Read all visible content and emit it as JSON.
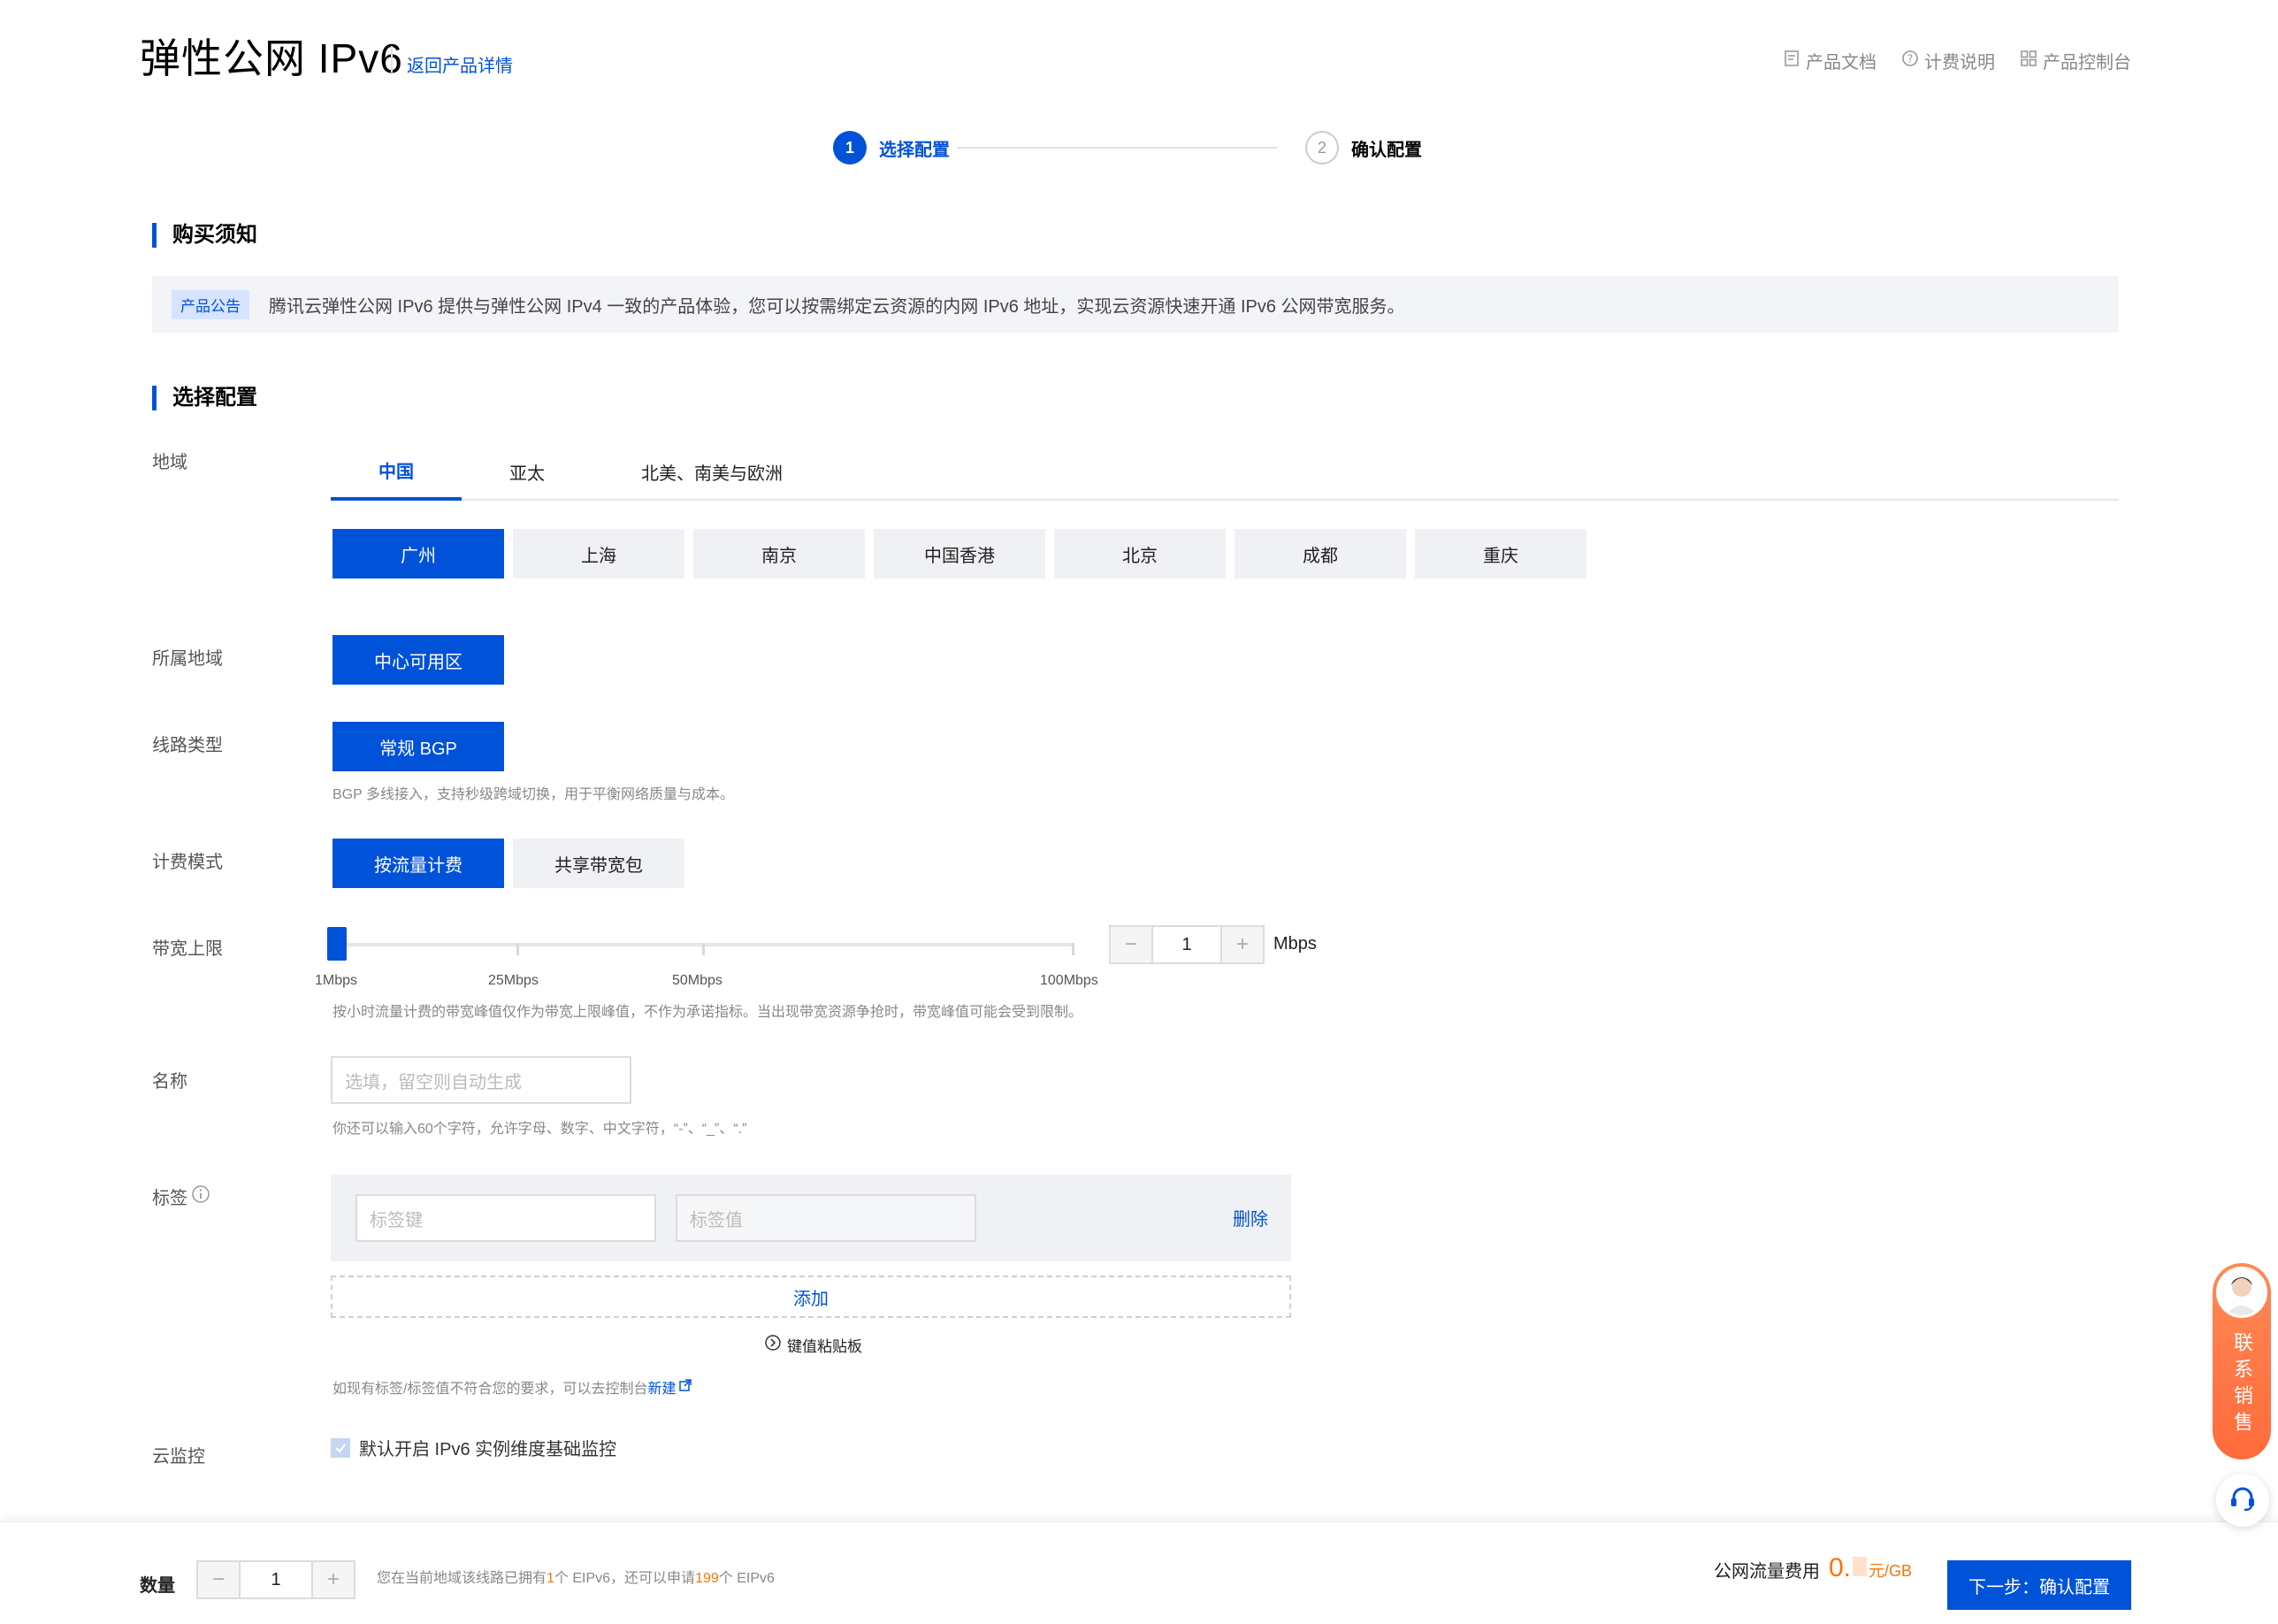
{
  "header": {
    "title": "弹性公网 IPv6",
    "back_link": "返回产品详情",
    "links": [
      {
        "label": "产品文档",
        "icon": "document-icon"
      },
      {
        "label": "计费说明",
        "icon": "question-circle-icon"
      },
      {
        "label": "产品控制台",
        "icon": "grid-icon"
      }
    ]
  },
  "steps": [
    {
      "number": "1",
      "label": "选择配置"
    },
    {
      "number": "2",
      "label": "确认配置"
    }
  ],
  "notice": {
    "section_title": "购买须知",
    "badge": "产品公告",
    "text": "腾讯云弹性公网 IPv6 提供与弹性公网 IPv4 一致的产品体验，您可以按需绑定云资源的内网 IPv6 地址，实现云资源快速开通 IPv6 公网带宽服务。"
  },
  "config": {
    "section_title": "选择配置",
    "region": {
      "label": "地域",
      "tabs": [
        "中国",
        "亚太",
        "北美、南美与欧洲"
      ],
      "cities": [
        "广州",
        "上海",
        "南京",
        "中国香港",
        "北京",
        "成都",
        "重庆"
      ]
    },
    "zone": {
      "label": "所属地域",
      "option": "中心可用区"
    },
    "line": {
      "label": "线路类型",
      "option": "常规 BGP",
      "hint": "BGP 多线接入，支持秒级跨域切换，用于平衡网络质量与成本。"
    },
    "billing": {
      "label": "计费模式",
      "options": [
        "按流量计费",
        "共享带宽包"
      ]
    },
    "bandwidth": {
      "label": "带宽上限",
      "ticks": [
        "1Mbps",
        "25Mbps",
        "50Mbps",
        "100Mbps"
      ],
      "value": "1",
      "unit": "Mbps",
      "minus": "−",
      "plus": "+",
      "hint": "按小时流量计费的带宽峰值仅作为带宽上限峰值，不作为承诺指标。当出现带宽资源争抢时，带宽峰值可能会受到限制。"
    },
    "name": {
      "label": "名称",
      "placeholder": "选填，留空则自动生成",
      "hint": "你还可以输入60个字符，允许字母、数字、中文字符，“-”、“_”、“.”"
    },
    "tags": {
      "label": "标签",
      "key_placeholder": "标签键",
      "value_placeholder": "标签值",
      "delete": "删除",
      "add": "添加",
      "clipboard": "键值粘贴板",
      "hint_prefix": "如现有标签/标签值不符合您的要求，可以去控制台",
      "hint_link": "新建"
    },
    "monitor": {
      "label": "云监控",
      "text": "默认开启 IPv6 实例维度基础监控"
    }
  },
  "footer": {
    "quantity_label": "数量",
    "quantity": "1",
    "minus": "−",
    "plus": "+",
    "info_1": "您在当前地域该线路已拥有",
    "owned": "1",
    "info_2": "个 EIPv6，还可以申请",
    "remaining": "199",
    "info_3": "个 EIPv6",
    "fee_label": "公网流量费用",
    "fee_value": "0.",
    "fee_unit": "元/GB",
    "next_button": "下一步：确认配置"
  },
  "side": {
    "sales": "联系销售"
  },
  "colors": {
    "primary": "#0052d9",
    "accent": "#ff7200"
  }
}
